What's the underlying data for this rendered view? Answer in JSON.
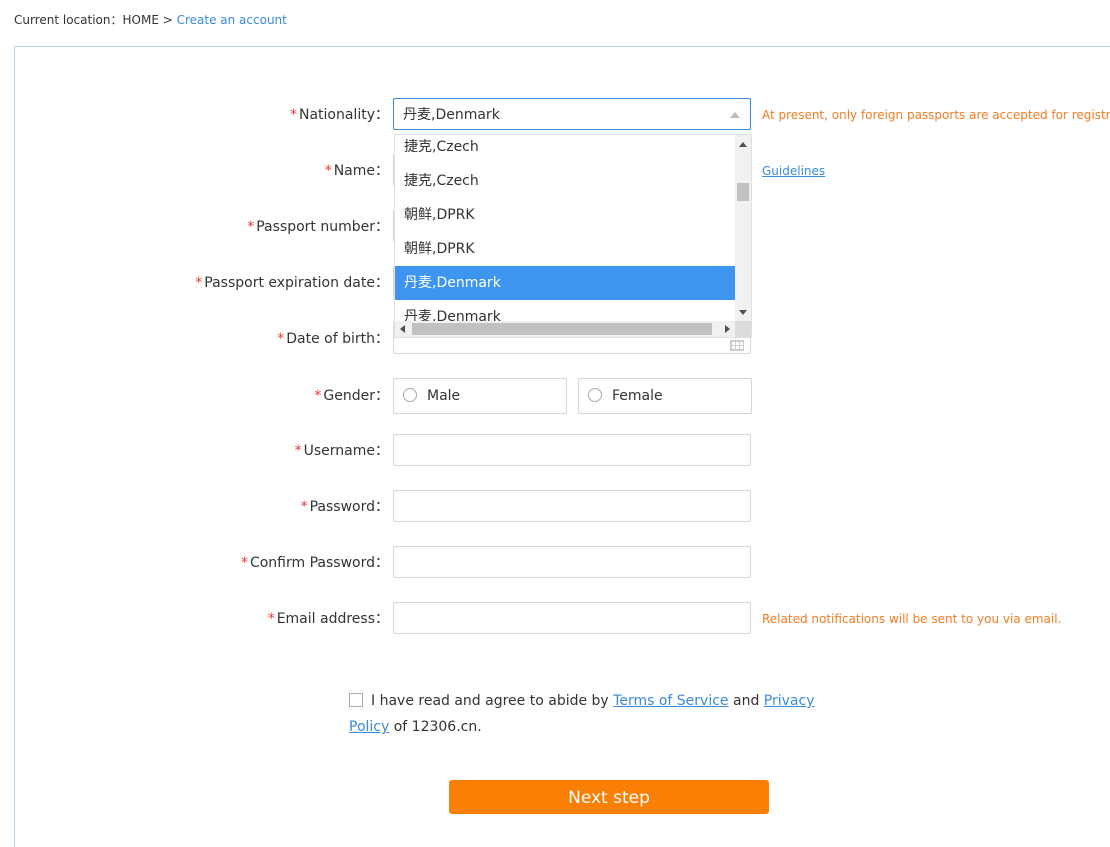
{
  "breadcrumb": {
    "prefix": "Current location：",
    "home": "HOME",
    "separator": " > ",
    "current": "Create an account"
  },
  "form": {
    "nationality": {
      "label": "Nationality：",
      "value": "丹麦,Denmark",
      "hint": "At present, only foreign passports are accepted for registration.",
      "options": [
        "捷克,Czech",
        "捷克,Czech",
        "朝鲜,DPRK",
        "朝鲜,DPRK",
        "丹麦,Denmark",
        "丹麦,Denmark"
      ],
      "selected_index": 4
    },
    "name": {
      "label": "Name：",
      "hint_link": "Guidelines"
    },
    "passport_number": {
      "label": "Passport number："
    },
    "passport_expiration": {
      "label": "Passport expiration date："
    },
    "date_of_birth": {
      "label": "Date of birth："
    },
    "gender": {
      "label": "Gender：",
      "male": "Male",
      "female": "Female"
    },
    "username": {
      "label": "Username："
    },
    "password": {
      "label": "Password："
    },
    "confirm_password": {
      "label": "Confirm Password："
    },
    "email": {
      "label": "Email address：",
      "hint": "Related notifications will be sent to you via email."
    },
    "required_mark": "*"
  },
  "agreement": {
    "text_before": "I have read and agree to abide by ",
    "terms": "Terms of Service",
    "and": " and ",
    "privacy": "Privacy Policy",
    "text_after": " of 12306.cn."
  },
  "next_button": "Next step",
  "colors": {
    "accent_blue": "#3b8ad8",
    "selected_option": "#3d95f0",
    "hint_orange": "#f27c22",
    "button_orange": "#fb7f05",
    "required_red": "#e53935"
  }
}
